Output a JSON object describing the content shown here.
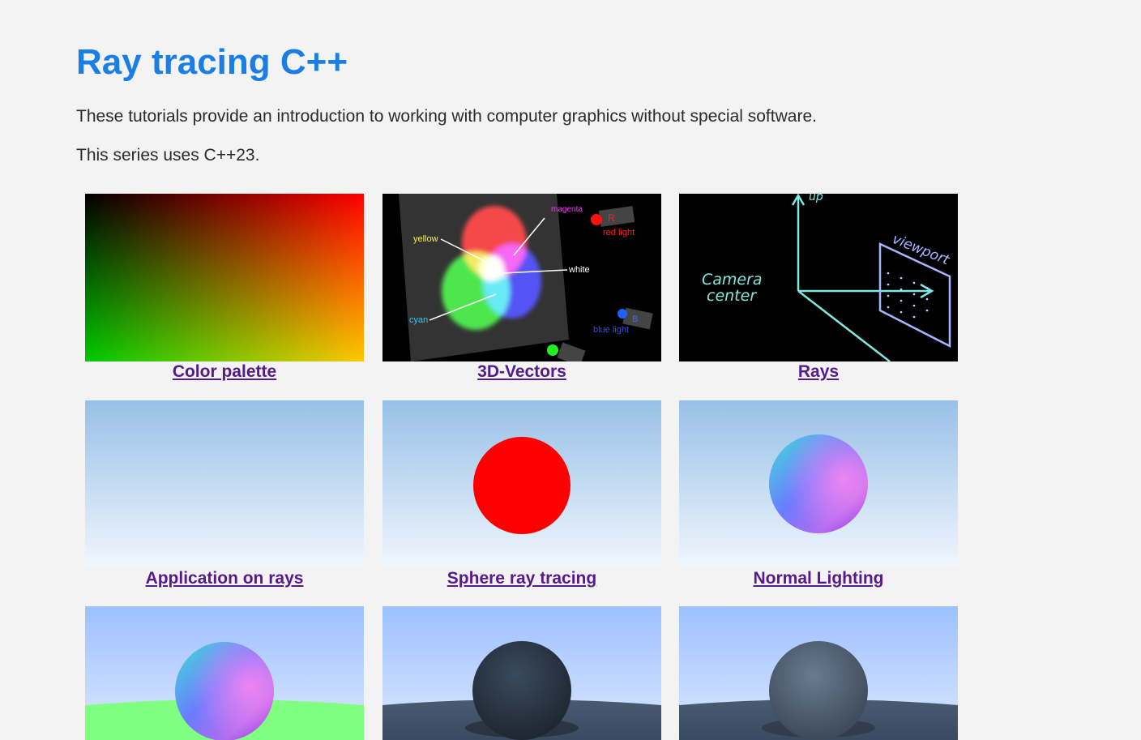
{
  "page": {
    "title": "Ray tracing C++",
    "intro": "These tutorials provide an introduction to working with computer graphics without special software.",
    "standard": "This series uses C++23."
  },
  "colors": {
    "title": "#1a7ee6",
    "link_visited": "#551a8b",
    "background": "#f3f3f3"
  },
  "tutorials": [
    {
      "label": "Color palette"
    },
    {
      "label": "3D-Vectors"
    },
    {
      "label": "Rays"
    },
    {
      "label": "Application on rays"
    },
    {
      "label": "Sphere ray tracing"
    },
    {
      "label": "Normal Lighting"
    },
    {
      "label": ""
    },
    {
      "label": ""
    },
    {
      "label": ""
    }
  ],
  "vectors_image": {
    "magenta": "magenta",
    "yellow": "yellow",
    "white": "white",
    "cyan": "cyan",
    "red_light": "red light",
    "blue_light": "blue light",
    "r": "R",
    "b": "B"
  },
  "rays_image": {
    "camera": "Camera",
    "center": "center",
    "viewport": "viewport",
    "up": "up"
  }
}
